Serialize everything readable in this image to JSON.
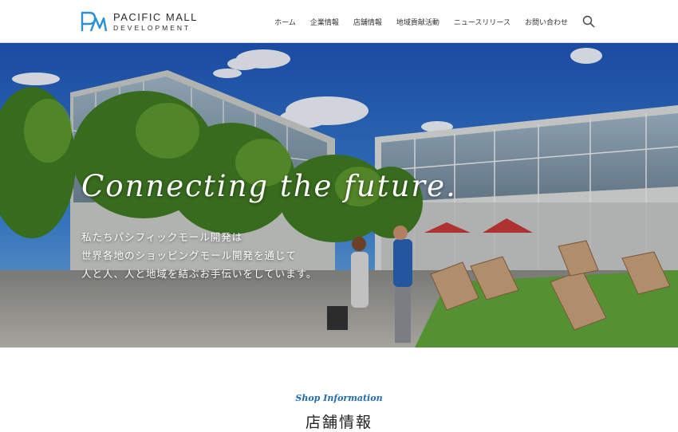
{
  "header": {
    "logo": {
      "mark": "PM",
      "name": "PACIFIC MALL",
      "sub": "DEVELOPMENT",
      "brand_color": "#2b8fd3"
    },
    "nav": [
      "ホーム",
      "企業情報",
      "店舗情報",
      "地域貢献活動",
      "ニュースリリース",
      "お問い合わせ"
    ],
    "search_icon": "search-icon"
  },
  "hero": {
    "title": "Connecting the future.",
    "copy": [
      "私たちパシフィックモール開発は",
      "世界各地のショッピングモール開発を通じて",
      "人と人、人と地域を結ぶお手伝いをしています。"
    ]
  },
  "section": {
    "title_en": "Shop Information",
    "title_ja": "店舗情報",
    "accent_color": "#1d6ab4"
  }
}
